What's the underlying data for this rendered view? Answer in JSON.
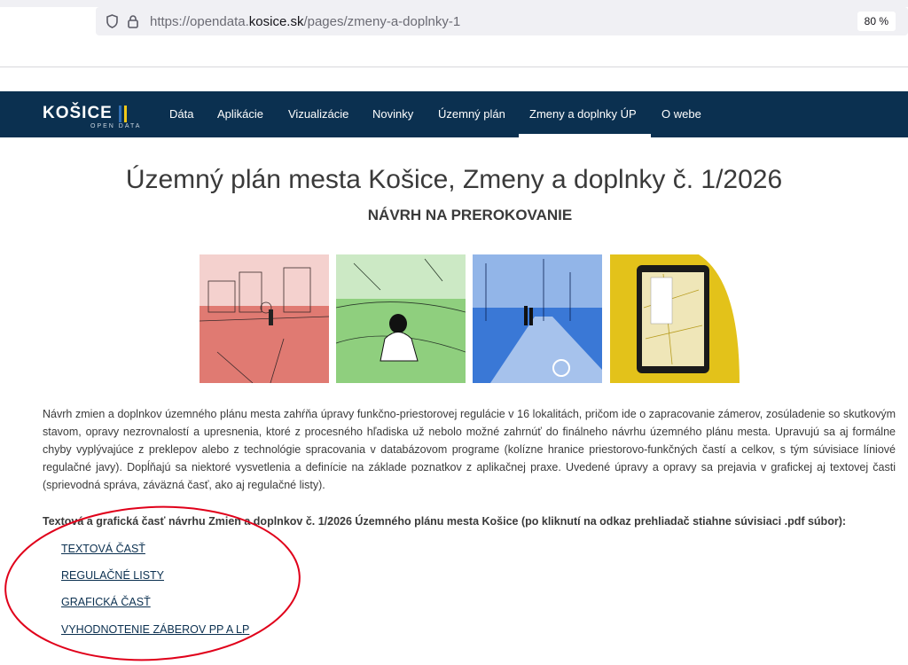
{
  "browser": {
    "url_prefix": "https://opendata.",
    "url_domain": "kosice.sk",
    "url_path": "/pages/zmeny-a-doplnky-1",
    "zoom": "80 %"
  },
  "site": {
    "logo_word": "KOŠICE",
    "logo_sub": "OPEN DATA",
    "logo_bar_colors": [
      "#2f6db5",
      "#f2c919"
    ],
    "nav": [
      "Dáta",
      "Aplikácie",
      "Vizualizácie",
      "Novinky",
      "Územný plán",
      "Zmeny a doplnky ÚP",
      "O webe"
    ],
    "nav_active_index": 5,
    "nav_bg": "#0b3050"
  },
  "content": {
    "title": "Územný plán mesta Košice, Zmeny a doplnky č. 1/2026",
    "subtitle": "NÁVRH NA PREROKOVANIE",
    "illustration_colors": [
      "#e07a72",
      "#8fcf7e",
      "#3a78d6",
      "#e3c21a"
    ],
    "description": "Návrh zmien a doplnkov územného plánu mesta zahŕňa úpravy funkčno-priestorovej regulácie v 16 lokalitách, pričom ide o zapracovanie zámerov, zosúladenie so skutkovým stavom, opravy nezrovnalostí a upresnenia, ktoré z procesného hľadiska už nebolo možné zahrnúť do finálneho návrhu územného plánu mesta. Upravujú sa aj formálne chyby vyplývajúce z preklepov alebo z technológie spracovania v databázovom programe (kolízne hranice priestorovo-funkčných častí a celkov, s tým súvisiace líniové regulačné javy). Dopĺňajú sa niektoré vysvetlenia a definície na základe poznatkov z aplikačnej praxe. Uvedené úpravy a opravy sa prejavia v grafickej aj textovej časti (sprievodná správa, záväzná časť, ako aj regulačné listy).",
    "links_heading": "Textová a grafická časť návrhu Zmien a doplnkov č. 1/2026 Územného plánu mesta Košice (po kliknutí na odkaz prehliadač stiahne súvisiaci .pdf súbor):",
    "links": [
      "TEXTOVÁ ČASŤ",
      "REGULAČNÉ LISTY",
      "GRAFICKÁ ČASŤ",
      "VYHODNOTENIE ZÁBEROV PP A LP"
    ],
    "annotation_color": "#e0001a"
  }
}
